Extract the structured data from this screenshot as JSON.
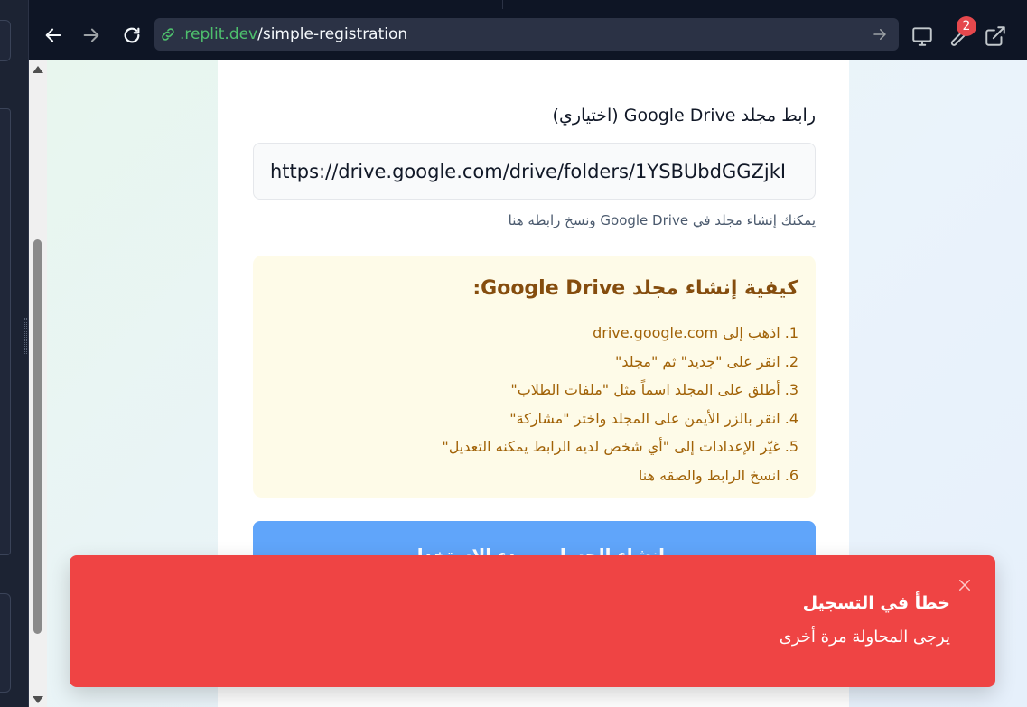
{
  "browser": {
    "url_domain": ".replit.dev",
    "url_path": "/simple-registration",
    "notification_count": "2",
    "icons": {
      "back": "arrow-left-icon",
      "forward": "arrow-right-icon",
      "reload": "reload-icon",
      "link": "link-icon",
      "go": "arrow-right-icon",
      "devtools": "monitor-icon",
      "tools": "wrench-icon",
      "open_external": "external-link-icon"
    }
  },
  "form": {
    "drive_label": "رابط مجلد Google Drive (اختياري)",
    "drive_value": "https://drive.google.com/drive/folders/1YSBUbdGGZjkI",
    "drive_hint": "يمكنك إنشاء مجلد في Google Drive ونسخ رابطه هنا",
    "howto": {
      "title": "كيفية إنشاء مجلد Google Drive:",
      "steps": [
        "1. اذهب إلى drive.google.com",
        "2. انقر على \"جديد\" ثم \"مجلد\"",
        "3. أطلق على المجلد اسماً مثل \"ملفات الطلاب\"",
        "4. انقر بالزر الأيمن على المجلد واختر \"مشاركة\"",
        "5. غيّر الإعدادات إلى \"أي شخص لديه الرابط يمكنه التعديل\"",
        "6. انسخ الرابط والصقه هنا"
      ]
    },
    "submit_label": "إنشاء الحساب وبدء الاستخدام"
  },
  "toast": {
    "title": "خطأ في التسجيل",
    "message": "يرجى المحاولة مرة أخرى",
    "close_icon": "close-icon"
  },
  "colors": {
    "toast_bg": "#ef4444",
    "submit_bg": "#60a5fa",
    "howto_bg": "#fefbe8",
    "howto_title": "#854d0e",
    "howto_text": "#a16207",
    "url_domain": "#4ec06d"
  }
}
